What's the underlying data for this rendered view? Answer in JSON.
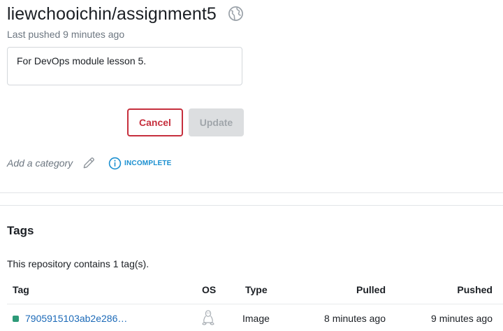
{
  "repo": {
    "title": "liewchooichin/assignment5",
    "last_pushed": "Last pushed 9 minutes ago",
    "visibility_icon": "globe-icon"
  },
  "description": {
    "value": "For DevOps module lesson 5."
  },
  "actions": {
    "cancel_label": "Cancel",
    "update_label": "Update"
  },
  "category": {
    "add_label": "Add a category",
    "edit_icon": "pencil-icon",
    "status_icon": "info-icon",
    "status_label": "INCOMPLETE",
    "status_color": "#1a8fd0"
  },
  "tags": {
    "heading": "Tags",
    "count_text": "This repository contains 1 tag(s).",
    "columns": [
      "Tag",
      "OS",
      "Type",
      "Pulled",
      "Pushed"
    ],
    "rows": [
      {
        "tag": "7905915103ab2e286…",
        "os_icon": "linux-icon",
        "type": "Image",
        "pulled": "8 minutes ago",
        "pushed": "9 minutes ago"
      }
    ]
  },
  "colors": {
    "danger": "#c62f3d",
    "link": "#1c6ab8",
    "tag_status": "#2d9a78",
    "disabled_bg": "#dcdee0"
  }
}
